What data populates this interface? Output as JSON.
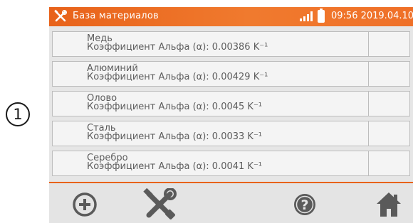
{
  "callout": {
    "number": "1"
  },
  "statusbar": {
    "title": "База материалов",
    "time": "09:56 2019.04.10"
  },
  "materials": [
    {
      "name": "Медь",
      "coefficient": "Коэффициент Альфа (α): 0.00386 K⁻¹"
    },
    {
      "name": "Алюминий",
      "coefficient": "Коэффициент Альфа (α): 0.00429 K⁻¹"
    },
    {
      "name": "Олово",
      "coefficient": "Коэффициент Альфа (α): 0.0045 K⁻¹"
    },
    {
      "name": "Сталь",
      "coefficient": "Коэффициент Альфа (α): 0.0033 K⁻¹"
    },
    {
      "name": "Серебро",
      "coefficient": "Коэффициент Альфа (α): 0.0041 K⁻¹"
    }
  ],
  "toolbar": {
    "buttons": [
      "add-icon",
      "tools-icon",
      "help-icon",
      "home-icon"
    ]
  },
  "colors": {
    "accent": "#e8621a",
    "icon": "#5a5a5a",
    "list_bg": "#f4f4f4",
    "screen_bg": "#e6e6e6"
  }
}
